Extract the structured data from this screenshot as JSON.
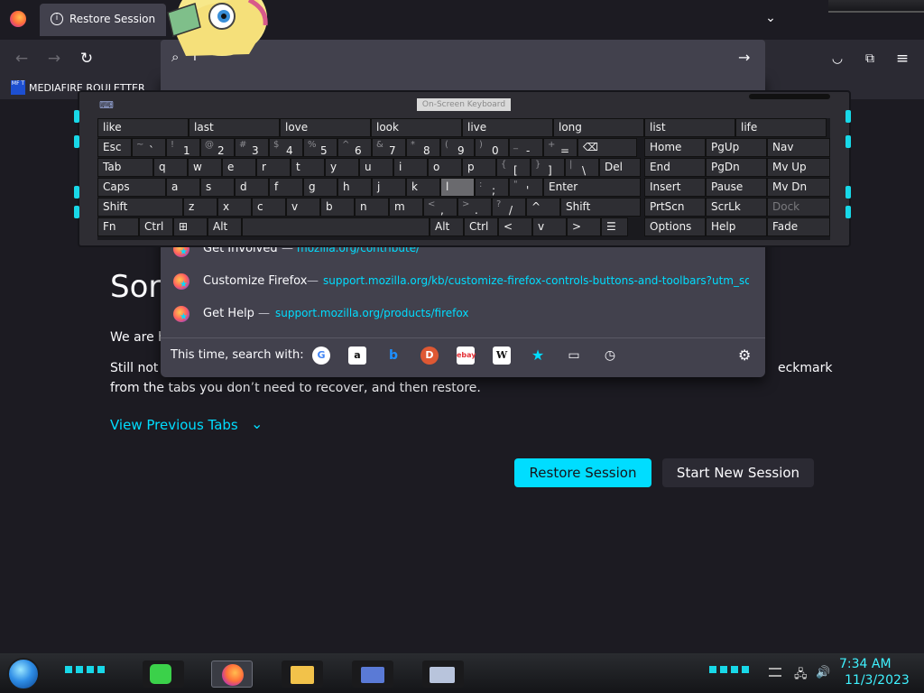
{
  "browser": {
    "tab_title": "Restore Session",
    "url_value": "l",
    "bookmark_label": "MEDIAFIRE ROULETTER",
    "bookmark_icon_text": "MF T"
  },
  "page": {
    "title": "Sorr",
    "p1": "We are h",
    "p2a": "Still not",
    "p2b": "eckmark",
    "p3": "from the tabs you don’t need to recover, and then restore.",
    "view_previous": "View Previous Tabs",
    "restore_button": "Restore Session",
    "new_session_button": "Start New Session"
  },
  "dropdown": {
    "rows": [
      {
        "title": "Get Involved",
        "url": "mozilla.org/contribute/"
      },
      {
        "title": "Customize Firefox",
        "url": "support.mozilla.org/kb/customize-firefox-controls-buttons-and-toolbars?utm_source=fi"
      },
      {
        "title": "Get Help",
        "url": "support.mozilla.org/products/firefox"
      }
    ],
    "separator": "—",
    "search_with_label": "This time, search with:",
    "engines": [
      "google-icon",
      "amazon-icon",
      "bing-icon",
      "duckduckgo-icon",
      "ebay-icon",
      "wikipedia-icon",
      "bookmarks-icon",
      "tabs-icon",
      "history-icon"
    ]
  },
  "osk": {
    "title": "On-Screen Keyboard",
    "predictions": [
      "like",
      "last",
      "love",
      "look",
      "live",
      "long",
      "list",
      "life"
    ],
    "row1": [
      {
        "m": "Esc"
      },
      {
        "s": "~",
        "m": "`"
      },
      {
        "s": "!",
        "m": "1"
      },
      {
        "s": "@",
        "m": "2"
      },
      {
        "s": "#",
        "m": "3"
      },
      {
        "s": "$",
        "m": "4"
      },
      {
        "s": "%",
        "m": "5"
      },
      {
        "s": "^",
        "m": "6"
      },
      {
        "s": "&",
        "m": "7"
      },
      {
        "s": "*",
        "m": "8"
      },
      {
        "s": "(",
        "m": "9"
      },
      {
        "s": ")",
        "m": "0"
      },
      {
        "s": "_",
        "m": "-"
      },
      {
        "s": "+",
        "m": "="
      },
      {
        "m": "⌫"
      }
    ],
    "row2": [
      {
        "m": "Tab"
      },
      {
        "m": "q"
      },
      {
        "m": "w"
      },
      {
        "m": "e"
      },
      {
        "m": "r"
      },
      {
        "m": "t"
      },
      {
        "m": "y"
      },
      {
        "m": "u"
      },
      {
        "m": "i"
      },
      {
        "m": "o"
      },
      {
        "m": "p"
      },
      {
        "s": "{",
        "m": "["
      },
      {
        "s": "}",
        "m": "]"
      },
      {
        "s": "|",
        "m": "\\"
      },
      {
        "m": "Del"
      }
    ],
    "row3": [
      {
        "m": "Caps"
      },
      {
        "m": "a"
      },
      {
        "m": "s"
      },
      {
        "m": "d"
      },
      {
        "m": "f"
      },
      {
        "m": "g"
      },
      {
        "m": "h"
      },
      {
        "m": "j"
      },
      {
        "m": "k"
      },
      {
        "m": "l"
      },
      {
        "s": ":",
        "m": ";"
      },
      {
        "s": "\"",
        "m": "'"
      },
      {
        "m": "Enter"
      }
    ],
    "row4": [
      {
        "m": "Shift"
      },
      {
        "m": "z"
      },
      {
        "m": "x"
      },
      {
        "m": "c"
      },
      {
        "m": "v"
      },
      {
        "m": "b"
      },
      {
        "m": "n"
      },
      {
        "m": "m"
      },
      {
        "s": "<",
        "m": ","
      },
      {
        "s": ">",
        "m": "."
      },
      {
        "s": "?",
        "m": "/"
      },
      {
        "m": "^"
      },
      {
        "m": "Shift"
      }
    ],
    "row5": [
      {
        "m": "Fn"
      },
      {
        "m": "Ctrl"
      },
      {
        "m": "⊞"
      },
      {
        "m": "Alt"
      },
      {
        "m": ""
      },
      {
        "m": "Alt"
      },
      {
        "m": "Ctrl"
      },
      {
        "m": "<"
      },
      {
        "m": "v"
      },
      {
        "m": ">"
      },
      {
        "m": "☰"
      }
    ],
    "side": [
      [
        "Home",
        "PgUp",
        "Nav"
      ],
      [
        "End",
        "PgDn",
        "Mv Up"
      ],
      [
        "Insert",
        "Pause",
        "Mv Dn"
      ],
      [
        "PrtScn",
        "ScrLk",
        "Dock"
      ],
      [
        "Options",
        "Help",
        "Fade"
      ]
    ]
  },
  "taskbar": {
    "time": "7:34 AM",
    "date": "11/3/2023"
  },
  "colors": {
    "accent": "#00ddff",
    "page_bg": "#1c1b22",
    "dropdown_bg": "#42414d"
  }
}
